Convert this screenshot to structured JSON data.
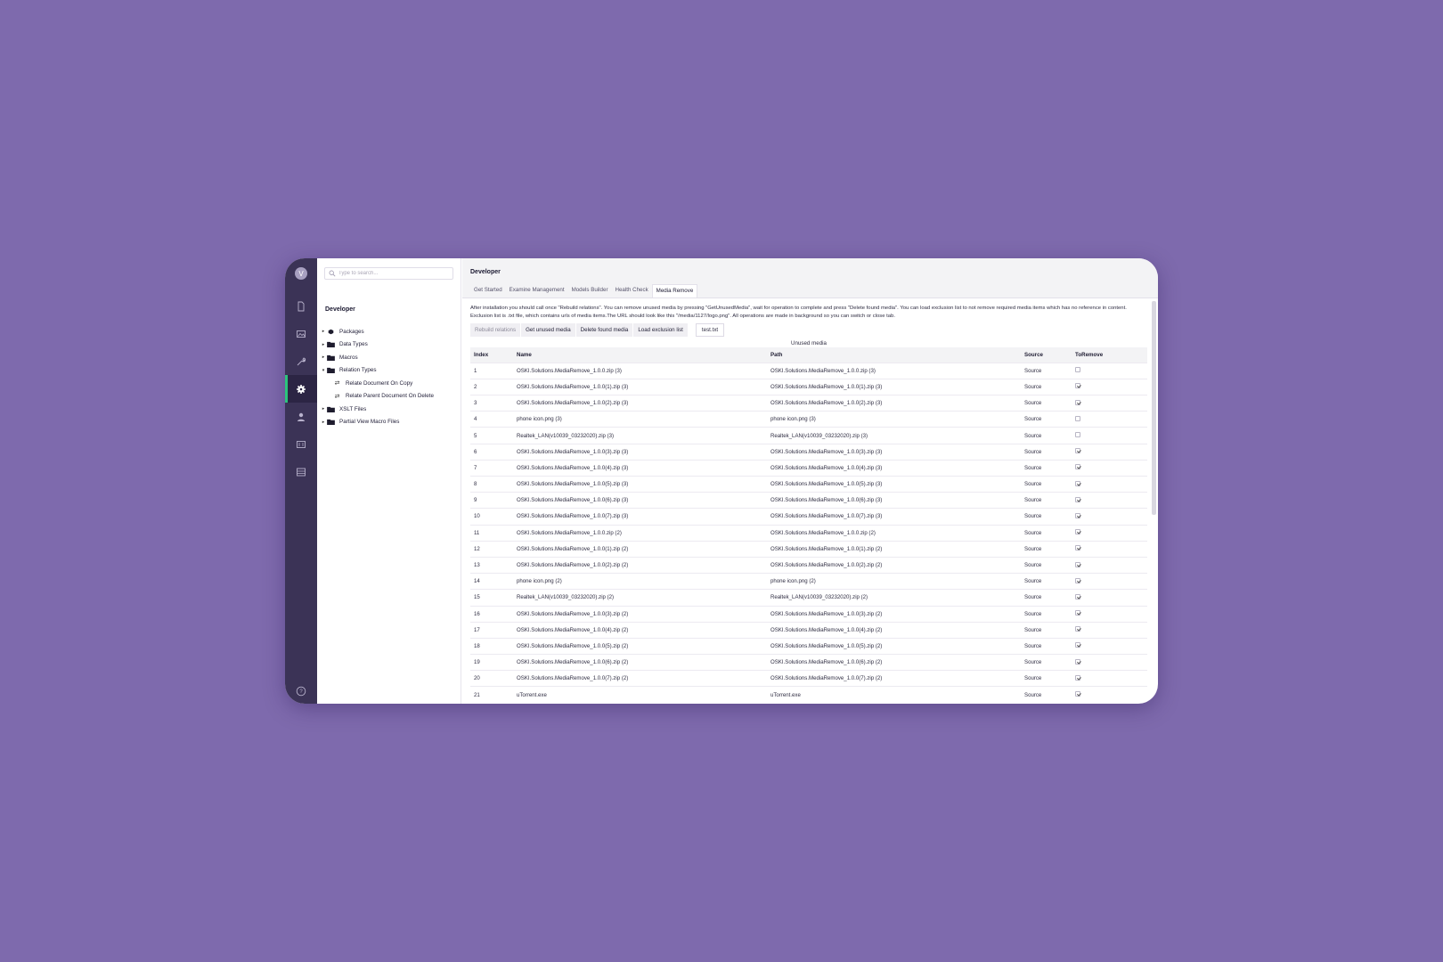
{
  "user": {
    "initial": "V"
  },
  "search": {
    "placeholder": "Type to search..."
  },
  "tree": {
    "title": "Developer",
    "items": [
      {
        "label": "Packages",
        "icon": "package-icon",
        "expanded": false
      },
      {
        "label": "Data Types",
        "icon": "folder-icon",
        "expanded": false
      },
      {
        "label": "Macros",
        "icon": "folder-icon",
        "expanded": false
      },
      {
        "label": "Relation Types",
        "icon": "folder-icon",
        "expanded": true
      },
      {
        "label": "Relate Document On Copy",
        "icon": "relation-icon",
        "child": true
      },
      {
        "label": "Relate Parent Document On Delete",
        "icon": "relation-icon",
        "child": true
      },
      {
        "label": "XSLT Files",
        "icon": "folder-icon",
        "expanded": false
      },
      {
        "label": "Partial View Macro Files",
        "icon": "folder-icon",
        "expanded": false
      }
    ]
  },
  "header": {
    "title": "Developer",
    "tabs": [
      "Get Started",
      "Examine Management",
      "Models Builder",
      "Health Check",
      "Media Remove"
    ],
    "active_tab": "Media Remove"
  },
  "media_remove": {
    "description": "After installation you should call once \"Rebuild relations\". You can remove unused media by pressing \"GetUnusedMedia\", wait for operation to complete and press \"Delete found media\". You can load exclusion list to not remove required media items which has no reference in content. Exclusion list is .txt file, which contains urls of media items.The URL should look like this \"/media/1127/logo.png\". All operations are made in background so you can switch or close tab.",
    "buttons": {
      "rebuild": "Rebuild relations",
      "get_unused": "Get unused media",
      "delete_found": "Delete found media",
      "load_exclusion": "Load exclusion list"
    },
    "file_name": "test.txt",
    "table_caption": "Unused media",
    "columns": [
      "Index",
      "Name",
      "Path",
      "Source",
      "ToRemove"
    ],
    "rows": [
      {
        "index": "1",
        "name": "OSKI.Solutions.MediaRemove_1.0.0.zip (3)",
        "path": "OSKI.Solutions.MediaRemove_1.0.0.zip (3)",
        "source": "Source",
        "remove": false
      },
      {
        "index": "2",
        "name": "OSKI.Solutions.MediaRemove_1.0.0(1).zip (3)",
        "path": "OSKI.Solutions.MediaRemove_1.0.0(1).zip (3)",
        "source": "Source",
        "remove": true
      },
      {
        "index": "3",
        "name": "OSKI.Solutions.MediaRemove_1.0.0(2).zip (3)",
        "path": "OSKI.Solutions.MediaRemove_1.0.0(2).zip (3)",
        "source": "Source",
        "remove": true
      },
      {
        "index": "4",
        "name": "phone icon.png (3)",
        "path": "phone icon.png (3)",
        "source": "Source",
        "remove": false
      },
      {
        "index": "5",
        "name": "Realtek_LAN(v10039_03232020).zip (3)",
        "path": "Realtek_LAN(v10039_03232020).zip (3)",
        "source": "Source",
        "remove": false
      },
      {
        "index": "6",
        "name": "OSKI.Solutions.MediaRemove_1.0.0(3).zip (3)",
        "path": "OSKI.Solutions.MediaRemove_1.0.0(3).zip (3)",
        "source": "Source",
        "remove": true
      },
      {
        "index": "7",
        "name": "OSKI.Solutions.MediaRemove_1.0.0(4).zip (3)",
        "path": "OSKI.Solutions.MediaRemove_1.0.0(4).zip (3)",
        "source": "Source",
        "remove": true
      },
      {
        "index": "8",
        "name": "OSKI.Solutions.MediaRemove_1.0.0(5).zip (3)",
        "path": "OSKI.Solutions.MediaRemove_1.0.0(5).zip (3)",
        "source": "Source",
        "remove": true
      },
      {
        "index": "9",
        "name": "OSKI.Solutions.MediaRemove_1.0.0(6).zip (3)",
        "path": "OSKI.Solutions.MediaRemove_1.0.0(6).zip (3)",
        "source": "Source",
        "remove": true
      },
      {
        "index": "10",
        "name": "OSKI.Solutions.MediaRemove_1.0.0(7).zip (3)",
        "path": "OSKI.Solutions.MediaRemove_1.0.0(7).zip (3)",
        "source": "Source",
        "remove": true
      },
      {
        "index": "11",
        "name": "OSKI.Solutions.MediaRemove_1.0.0.zip (2)",
        "path": "OSKI.Solutions.MediaRemove_1.0.0.zip (2)",
        "source": "Source",
        "remove": true
      },
      {
        "index": "12",
        "name": "OSKI.Solutions.MediaRemove_1.0.0(1).zip (2)",
        "path": "OSKI.Solutions.MediaRemove_1.0.0(1).zip (2)",
        "source": "Source",
        "remove": true
      },
      {
        "index": "13",
        "name": "OSKI.Solutions.MediaRemove_1.0.0(2).zip (2)",
        "path": "OSKI.Solutions.MediaRemove_1.0.0(2).zip (2)",
        "source": "Source",
        "remove": true
      },
      {
        "index": "14",
        "name": "phone icon.png (2)",
        "path": "phone icon.png (2)",
        "source": "Source",
        "remove": true
      },
      {
        "index": "15",
        "name": "Realtek_LAN(v10039_03232020).zip (2)",
        "path": "Realtek_LAN(v10039_03232020).zip (2)",
        "source": "Source",
        "remove": true
      },
      {
        "index": "16",
        "name": "OSKI.Solutions.MediaRemove_1.0.0(3).zip (2)",
        "path": "OSKI.Solutions.MediaRemove_1.0.0(3).zip (2)",
        "source": "Source",
        "remove": true
      },
      {
        "index": "17",
        "name": "OSKI.Solutions.MediaRemove_1.0.0(4).zip (2)",
        "path": "OSKI.Solutions.MediaRemove_1.0.0(4).zip (2)",
        "source": "Source",
        "remove": true
      },
      {
        "index": "18",
        "name": "OSKI.Solutions.MediaRemove_1.0.0(5).zip (2)",
        "path": "OSKI.Solutions.MediaRemove_1.0.0(5).zip (2)",
        "source": "Source",
        "remove": true
      },
      {
        "index": "19",
        "name": "OSKI.Solutions.MediaRemove_1.0.0(6).zip (2)",
        "path": "OSKI.Solutions.MediaRemove_1.0.0(6).zip (2)",
        "source": "Source",
        "remove": true
      },
      {
        "index": "20",
        "name": "OSKI.Solutions.MediaRemove_1.0.0(7).zip (2)",
        "path": "OSKI.Solutions.MediaRemove_1.0.0(7).zip (2)",
        "source": "Source",
        "remove": true
      },
      {
        "index": "21",
        "name": "uTorrent.exe",
        "path": "uTorrent.exe",
        "source": "Source",
        "remove": true
      }
    ]
  },
  "rail": {
    "items": [
      "content-icon",
      "media-icon",
      "settings-wrench-icon",
      "developer-gear-icon",
      "users-icon",
      "members-icon",
      "forms-icon"
    ],
    "active": "developer-gear-icon",
    "help": "help-icon"
  },
  "colors": {
    "background": "#7e6aad",
    "rail": "#3b3356",
    "accent": "#2bc37c"
  }
}
